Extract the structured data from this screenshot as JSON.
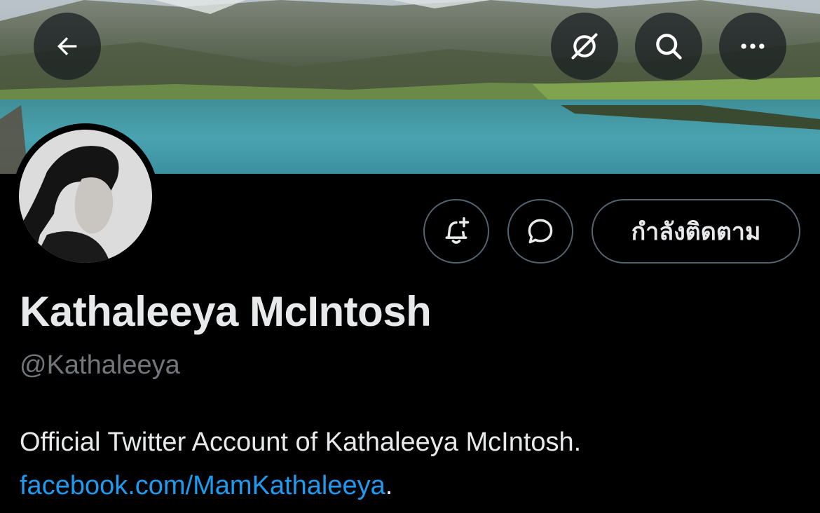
{
  "profile": {
    "display_name": "Kathaleeya McIntosh",
    "handle": "@Kathaleeya",
    "bio_text": "Official Twitter Account of Kathaleeya McIntosh.",
    "bio_link": "facebook.com/MamKathaleeya",
    "bio_link_suffix": "."
  },
  "header": {
    "icons": [
      "back-arrow-icon",
      "grok-icon",
      "search-icon",
      "more-icon"
    ]
  },
  "actions": {
    "notify_icon": "bell-plus-icon",
    "message_icon": "message-bubble-icon",
    "follow_label": "กำลังติดตาม"
  },
  "colors": {
    "background": "#000000",
    "text": "#e7e9ea",
    "muted": "#71767b",
    "link": "#1d9bf0",
    "border": "#536471"
  }
}
